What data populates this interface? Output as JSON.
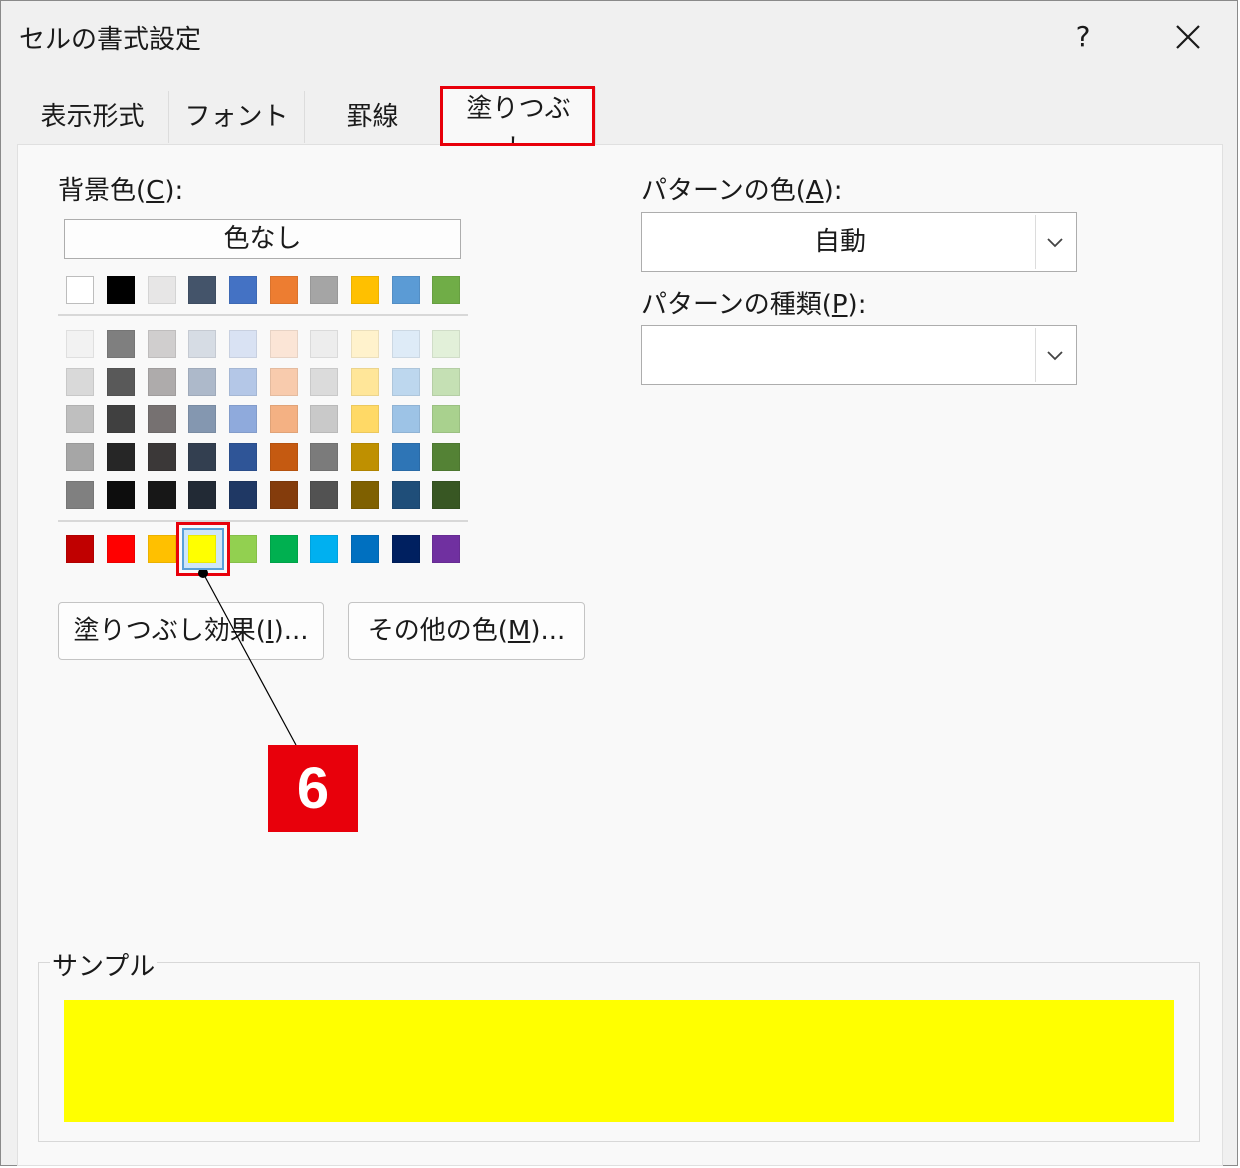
{
  "dialog": {
    "title": "セルの書式設定",
    "help": "?"
  },
  "tabs": [
    "表示形式",
    "フォント",
    "罫線",
    "塗りつぶし"
  ],
  "background": {
    "label": "背景色(",
    "accel": "C",
    "label_end": "):",
    "no_color": "色なし",
    "theme_row": [
      "#ffffff",
      "#000000",
      "#e7e6e6",
      "#44546a",
      "#4472c4",
      "#ed7d31",
      "#a5a5a5",
      "#ffc000",
      "#5b9bd5",
      "#70ad47"
    ],
    "tint_rows": [
      [
        "#f2f2f2",
        "#7f7f7f",
        "#d0cece",
        "#d6dce4",
        "#d9e2f3",
        "#fbe5d6",
        "#ededed",
        "#fff2cc",
        "#deebf7",
        "#e2f0d9"
      ],
      [
        "#d9d9d9",
        "#595959",
        "#aeabab",
        "#adb9ca",
        "#b4c7e7",
        "#f8cbad",
        "#dbdbdb",
        "#ffe699",
        "#bdd7ee",
        "#c5e0b4"
      ],
      [
        "#bfbfbf",
        "#404040",
        "#767171",
        "#8497b0",
        "#8faadc",
        "#f4b183",
        "#c9c9c9",
        "#ffd966",
        "#9dc3e6",
        "#a9d18e"
      ],
      [
        "#a6a6a6",
        "#262626",
        "#3b3838",
        "#333f50",
        "#2f5597",
        "#c55a11",
        "#7b7b7b",
        "#bf9000",
        "#2e75b6",
        "#548235"
      ],
      [
        "#808080",
        "#0d0d0d",
        "#171717",
        "#222a35",
        "#1f3864",
        "#843c0c",
        "#525252",
        "#7f6000",
        "#1f4e79",
        "#385723"
      ]
    ],
    "standard_row": [
      "#c00000",
      "#ff0000",
      "#ffc000",
      "#ffff00",
      "#92d050",
      "#00b050",
      "#00b0f0",
      "#0070c0",
      "#002060",
      "#7030a0"
    ],
    "selected_index": 3,
    "fill_effects_button": "塗りつぶし効果(",
    "fill_effects_accel": "I",
    "fill_effects_end": ")...",
    "more_colors_button": "その他の色(",
    "more_colors_accel": "M",
    "more_colors_end": ")..."
  },
  "pattern_color": {
    "label": "パターンの色(",
    "accel": "A",
    "label_end": "):",
    "value": "自動"
  },
  "pattern_style": {
    "label": "パターンの種類(",
    "accel": "P",
    "label_end": "):",
    "value": ""
  },
  "sample": {
    "label": "サンプル",
    "color": "#ffff00"
  },
  "annotation": {
    "step": "6",
    "highlight_color": "#e8000b"
  }
}
